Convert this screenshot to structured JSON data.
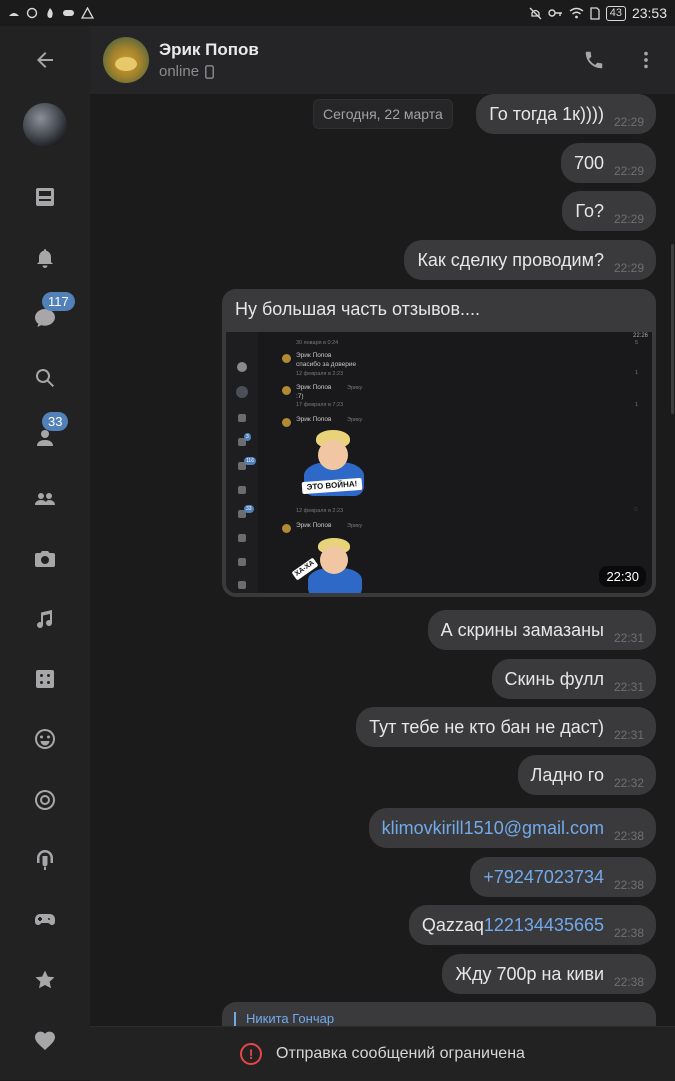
{
  "status_bar": {
    "time": "23:53",
    "battery": "43",
    "left_icons": [
      "android-icon",
      "whatsapp-icon",
      "fire-icon",
      "game-icon",
      "warning-icon"
    ],
    "right_icons": [
      "mute-icon",
      "key-icon",
      "wifi-icon",
      "sim-icon"
    ]
  },
  "sidebar": {
    "items": [
      {
        "icon": "back-arrow-icon"
      },
      {
        "icon": "profile-avatar"
      },
      {
        "icon": "news-icon"
      },
      {
        "icon": "bell-icon"
      },
      {
        "icon": "messages-icon",
        "badge": "117"
      },
      {
        "icon": "search-icon"
      },
      {
        "icon": "friends-icon",
        "badge": "33"
      },
      {
        "icon": "groups-icon"
      },
      {
        "icon": "camera-icon"
      },
      {
        "icon": "music-icon"
      },
      {
        "icon": "dice-icon"
      },
      {
        "icon": "smile-icon"
      },
      {
        "icon": "target-icon"
      },
      {
        "icon": "podcast-icon"
      },
      {
        "icon": "gamepad-icon"
      },
      {
        "icon": "star-icon"
      },
      {
        "icon": "heart-icon"
      }
    ]
  },
  "header": {
    "name": "Эрик Попов",
    "status": "online"
  },
  "chat": {
    "date_divider": "Сегодня, 22 марта",
    "messages": [
      {
        "text": "Го тогда 1к))))",
        "time": "22:29"
      },
      {
        "text": "700",
        "time": "22:29"
      },
      {
        "text": "Го?",
        "time": "22:29"
      },
      {
        "text": "Как сделку проводим?",
        "time": "22:29"
      },
      {
        "text": "А скрины замазаны",
        "time": "22:31"
      },
      {
        "text": "Скинь фулл",
        "time": "22:31"
      },
      {
        "text": "Тут тебе не кто бан не даст)",
        "time": "22:31"
      },
      {
        "text": "Ладно го",
        "time": "22:32"
      },
      {
        "link": "klimovkirill1510@gmail.com",
        "time": "22:38"
      },
      {
        "link": "+79247023734",
        "time": "22:38"
      },
      {
        "prefix": "Qazzaq",
        "link": "122134435665",
        "time": "22:38"
      },
      {
        "text": "Жду 700р на киви",
        "time": "22:38"
      }
    ],
    "photo_message": {
      "caption": "Ну большая часть отзывов....",
      "time": "22:30",
      "screenshot": {
        "status_time": "22:26",
        "entries": [
          {
            "date": "30 января в 0:24",
            "count": "5"
          },
          {
            "name": "Эрик Попов",
            "text": "спасибо за доверие",
            "date": "12 февраля в 2:23",
            "count": "1"
          },
          {
            "name": "Эрик Попов",
            "reply": "Эрику",
            "text": ":7)",
            "date": "17 февраля в 7:23",
            "count": "1"
          },
          {
            "name": "Эрик Попов",
            "reply": "Эрику",
            "sticker_text": "ЭТО ВОЙНА!",
            "date": "12 февраля в 2:23"
          },
          {
            "name": "Эрик Попов",
            "reply": "Эрику",
            "sticker_text": "ХА-ХА"
          }
        ],
        "rail_badges": [
          "3",
          "116",
          "33"
        ]
      }
    },
    "reply_preview_name": "Никита Гончар"
  },
  "footer": {
    "restriction_text": "Отправка сообщений ограничена"
  }
}
